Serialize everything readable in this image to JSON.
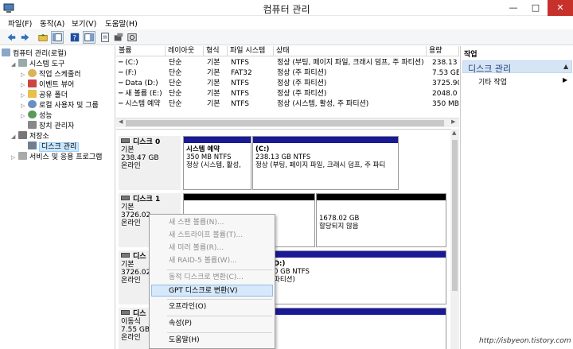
{
  "window": {
    "title": "컴퓨터 관리"
  },
  "menu": [
    "파일(F)",
    "동작(A)",
    "보기(V)",
    "도움말(H)"
  ],
  "tree": {
    "root": "컴퓨터 관리(로컬)",
    "system_tools": "시스템 도구",
    "task_scheduler": "작업 스케줄러",
    "event_viewer": "이벤트 뷰어",
    "shared_folders": "공유 폴더",
    "local_users": "로컬 사용자 및 그룹",
    "performance": "성능",
    "device_manager": "장치 관리자",
    "storage": "저장소",
    "disk_management": "디스크 관리",
    "services_apps": "서비스 및 응용 프로그램"
  },
  "volumes": {
    "headers": [
      "볼륨",
      "레이아웃",
      "형식",
      "파일 시스템",
      "상태",
      "용량"
    ],
    "rows": [
      [
        "(C:)",
        "단순",
        "기본",
        "NTFS",
        "정상 (부팅, 페이지 파일, 크래시 덤프, 주 파티션)",
        "238.13"
      ],
      [
        "(F:)",
        "단순",
        "기본",
        "FAT32",
        "정상 (주 파티션)",
        "7.53 GB"
      ],
      [
        "Data (D:)",
        "단순",
        "기본",
        "NTFS",
        "정상 (주 파티션)",
        "3725.90"
      ],
      [
        "새 볼륨 (E:)",
        "단순",
        "기본",
        "NTFS",
        "정상 (주 파티션)",
        "2048.0"
      ],
      [
        "시스템 예약",
        "단순",
        "기본",
        "NTFS",
        "정상 (시스템, 활성, 주 파티션)",
        "350 MB"
      ]
    ]
  },
  "disks": {
    "disk0": {
      "name": "디스크 0",
      "type": "기본",
      "size": "238.47 GB",
      "status": "온라인",
      "p1": {
        "name": "시스템 예약",
        "size": "350 MB NTFS",
        "status": "정상 (시스템, 활성,"
      },
      "p2": {
        "name": "(C:)",
        "size": "238.13 GB NTFS",
        "status": "정상 (부팅, 페이지 파일, 크래시 덤프, 주 파티"
      }
    },
    "disk1": {
      "name": "디스크 1",
      "type": "기본",
      "size": "3726.02",
      "status": "온라인",
      "p2": {
        "size": "1678.02 GB",
        "status": "할당되지 않음"
      }
    },
    "disk2": {
      "name": "디스",
      "type": "기본",
      "size": "3726.02",
      "status": "온라인",
      "p1": {
        "name": "D:)",
        "size": "0 GB NTFS",
        "status": "파티션)"
      }
    },
    "disk3": {
      "name": "디스",
      "type": "이동식",
      "size": "7.55 GB",
      "status": "온라인"
    }
  },
  "actions": {
    "header": "작업",
    "section": "디스크 관리",
    "more": "기타 작업"
  },
  "context_menu": [
    "새 스팬 볼륨(N)...",
    "새 스트라이프 볼륨(T)...",
    "새 미러 볼륨(R)...",
    "새 RAID-5 볼륨(W)...",
    "동적 디스크로 변환(C)...",
    "GPT 디스크로 변환(V)",
    "오프라인(O)",
    "속성(P)",
    "도움말(H)"
  ],
  "watermark": "http://isbyeon.tistory.com",
  "colors": {
    "partition_bar": "#1a1a96",
    "unallocated_bar": "#000000",
    "highlight": "#d6e8fa",
    "close_button": "#c7312b"
  }
}
